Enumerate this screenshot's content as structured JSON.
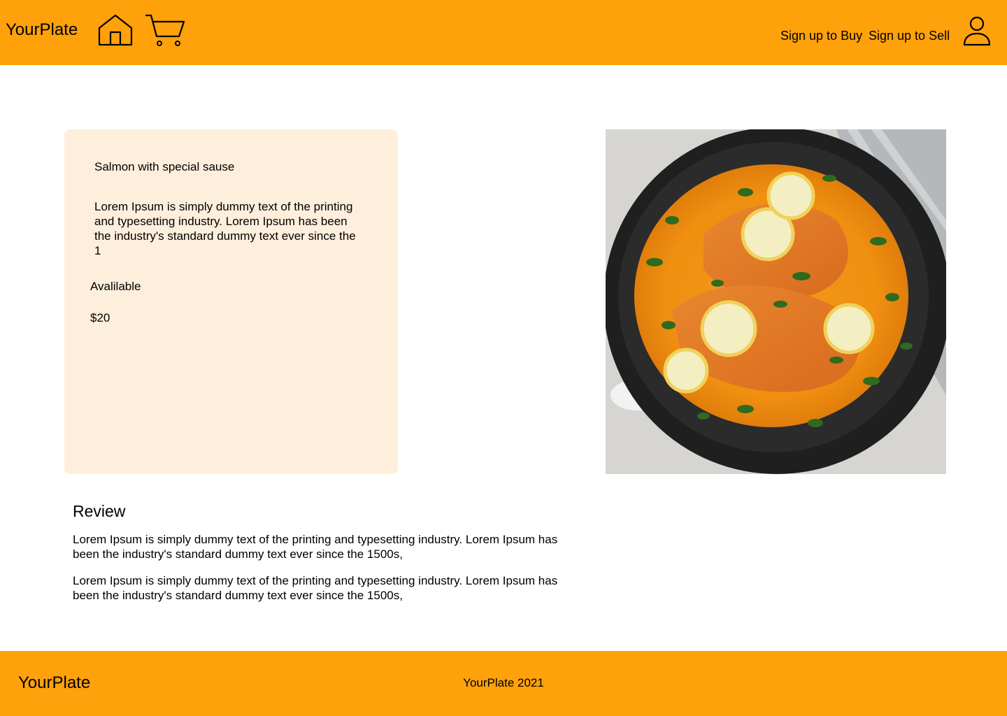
{
  "colors": {
    "brand": "#FFA10A",
    "card": "#FEEFDC",
    "text": "#000000"
  },
  "header": {
    "brand": "YourPlate",
    "icons": {
      "home": "home-icon",
      "cart": "cart-icon",
      "user": "user-icon"
    },
    "nav": {
      "signup_buy": "Sign up to Buy",
      "signup_sell": "Sign up to Sell"
    }
  },
  "product": {
    "title": "Salmon with special sause",
    "description": "Lorem Ipsum is simply dummy text of the printing and typesetting industry. Lorem Ipsum has been the industry's standard dummy text ever since the 1",
    "availability": "Avalilable",
    "price": "$20",
    "image": "salmon-dish-photo"
  },
  "review": {
    "heading": "Review",
    "items": [
      "Lorem Ipsum is simply dummy text of the printing and typesetting industry. Lorem Ipsum has been the industry's standard dummy text ever since the 1500s,",
      "Lorem Ipsum is simply dummy text of the printing and typesetting industry. Lorem Ipsum has been the industry's standard dummy text ever since the 1500s,"
    ]
  },
  "footer": {
    "brand": "YourPlate",
    "copyright": "YourPlate 2021"
  }
}
